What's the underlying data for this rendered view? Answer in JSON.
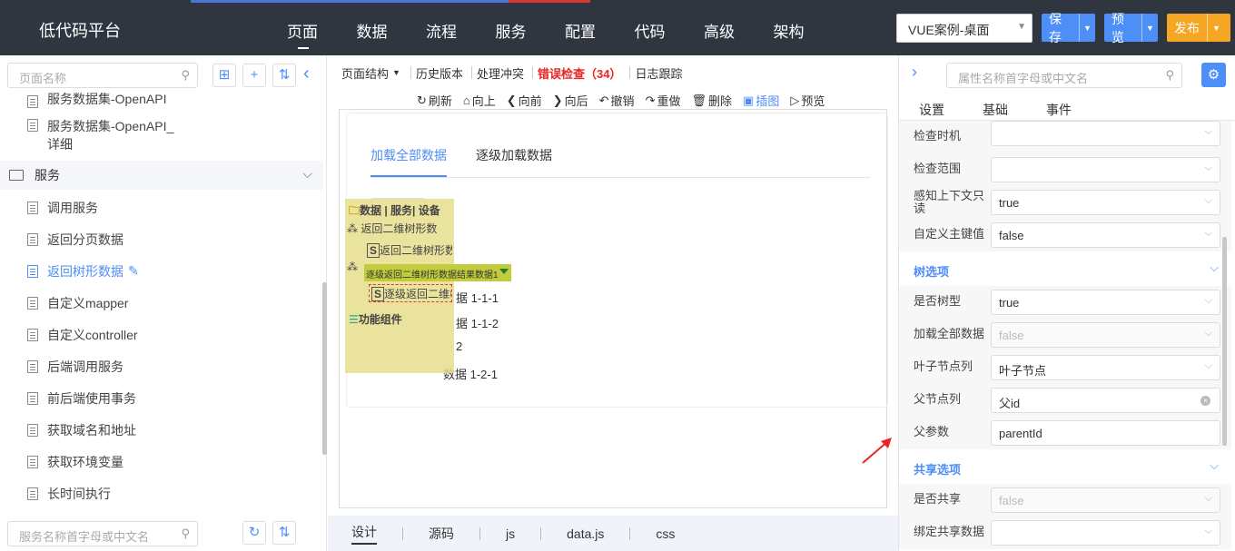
{
  "app": {
    "title": "低代码平台"
  },
  "nav": [
    "页面",
    "数据",
    "流程",
    "服务",
    "配置",
    "代码",
    "高级",
    "架构"
  ],
  "project": {
    "value": "VUE案例-桌面"
  },
  "header_buttons": {
    "save": "保存",
    "preview": "预览",
    "publish": "发布"
  },
  "left": {
    "search_placeholder": "页面名称",
    "top_partial": "服务数据集-OpenAPI",
    "items_before": [
      {
        "label": "服务数据集-OpenAPI_\n详细"
      }
    ],
    "group": "服务",
    "items": [
      {
        "label": "调用服务"
      },
      {
        "label": "返回分页数据"
      },
      {
        "label": "返回树形数据",
        "selected": true
      },
      {
        "label": "自定义mapper"
      },
      {
        "label": "自定义controller"
      },
      {
        "label": "后端调用服务"
      },
      {
        "label": "前后端使用事务"
      },
      {
        "label": "获取域名和地址"
      },
      {
        "label": "获取环境变量"
      },
      {
        "label": "长时间执行"
      }
    ],
    "bottom_search_placeholder": "服务名称首字母或中文名"
  },
  "center": {
    "toolbar": {
      "structure": "页面结构",
      "history": "历史版本",
      "conflict": "处理冲突",
      "error": "错误检查（34）",
      "log": "日志跟踪"
    },
    "actions": {
      "refresh": "刷新",
      "up": "向上",
      "forward": "向前",
      "back": "向后",
      "undo": "撤销",
      "redo": "重做",
      "delete": "删除",
      "insert": "插图",
      "preview": "预览"
    },
    "tabs": [
      "加载全部数据",
      "逐级加载数据"
    ],
    "tree_nodes": {
      "n1": "据 1-1-1",
      "n2": "据 1-1-2",
      "n3": "2",
      "n4": "数据 1-2-1"
    },
    "overlay": {
      "title": "数据 | 服务| 设备",
      "item1": "返回二维树形数",
      "item1_sub": "返回二维树形数",
      "selected": "逐级返回二维树形数据结果数据1",
      "selected_sub": "逐级返回二维树",
      "component": "功能组件"
    },
    "bottom_tabs": [
      "设计",
      "源码",
      "js",
      "data.js",
      "css"
    ]
  },
  "right": {
    "search_placeholder": "属性名称首字母或中文名",
    "tabs": [
      "设置",
      "基础",
      "事件"
    ],
    "props_a": [
      {
        "label": "检查时机",
        "value": "",
        "type": "select"
      },
      {
        "label": "检查范围",
        "value": "",
        "type": "select"
      },
      {
        "label": "感知上下文只读",
        "value": "true",
        "type": "select",
        "two": true
      },
      {
        "label": "自定义主键值",
        "value": "false",
        "type": "select"
      }
    ],
    "section_tree": "树选项",
    "props_b": [
      {
        "label": "是否树型",
        "value": "true",
        "type": "select"
      },
      {
        "label": "加载全部数据",
        "value": "false",
        "type": "select",
        "disabled": true
      },
      {
        "label": "叶子节点列",
        "value": "叶子节点",
        "type": "select"
      },
      {
        "label": "父节点列",
        "value": "父id",
        "type": "clear"
      },
      {
        "label": "父参数",
        "value": "parentId",
        "type": "text"
      }
    ],
    "section_share": "共享选项",
    "props_c": [
      {
        "label": "是否共享",
        "value": "false",
        "type": "select",
        "disabled": true
      },
      {
        "label": "绑定共享数据",
        "value": "",
        "type": "select"
      }
    ]
  },
  "colors": {
    "accent": "#4e8ef7",
    "topbar": "#2f3640",
    "publish": "#f5a623",
    "error": "#e22"
  }
}
